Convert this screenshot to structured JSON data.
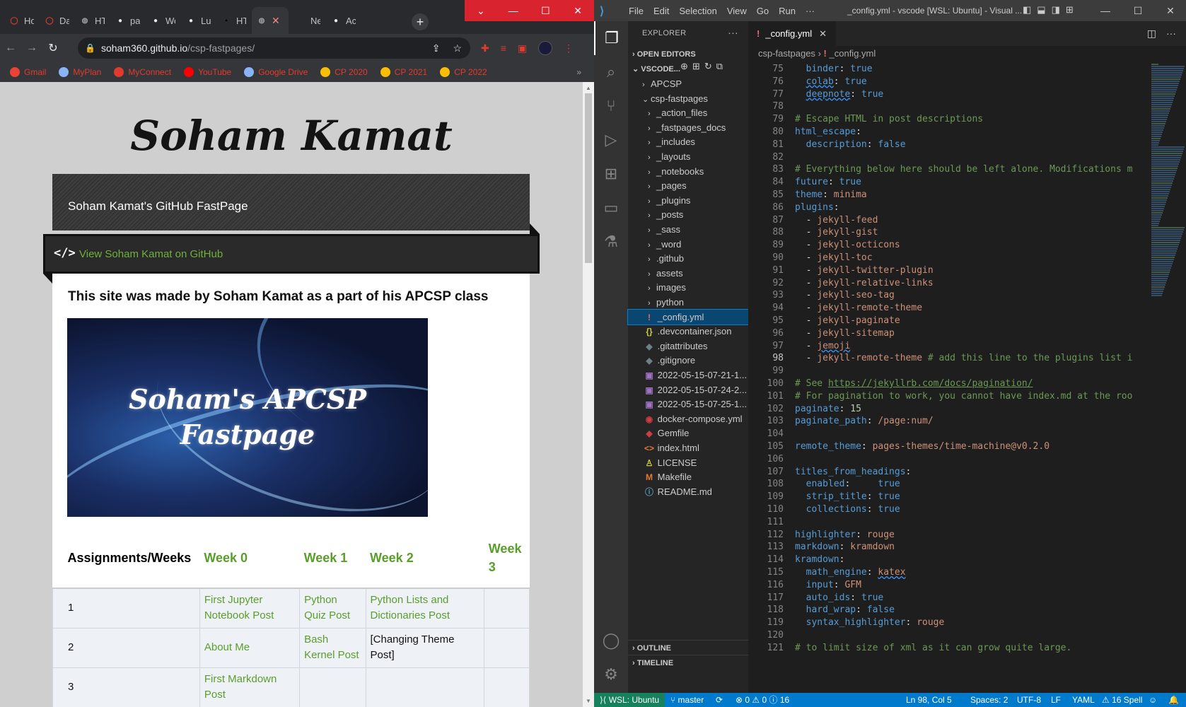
{
  "chrome": {
    "tabs": [
      {
        "label": "Ho",
        "icon": "opera-icon"
      },
      {
        "label": "Da",
        "icon": "opera-icon"
      },
      {
        "label": "HT",
        "icon": "globe-icon"
      },
      {
        "label": "pa",
        "icon": "github-icon"
      },
      {
        "label": "We",
        "icon": "github-icon"
      },
      {
        "label": "Luc",
        "icon": "github-icon"
      },
      {
        "label": "HT",
        "icon": "terminal-icon"
      },
      {
        "label": "",
        "icon": "globe-icon",
        "active": true
      },
      {
        "label": "Ne",
        "icon": "blank-icon"
      },
      {
        "label": "Ac",
        "icon": "github-icon"
      }
    ],
    "active_tab_close": "✕",
    "new_tab": "+",
    "window_controls": [
      "⌄",
      "—",
      "☐",
      "✕"
    ],
    "url_host": "soham360.github.io",
    "url_path": "/csp-fastpages/",
    "bookmarks": [
      {
        "label": "Gmail",
        "color": "#ea4335"
      },
      {
        "label": "MyPlan",
        "color": "#8ab4f8"
      },
      {
        "label": "MyConnect",
        "color": "#e23b2e"
      },
      {
        "label": "YouTube",
        "color": "#ff0000"
      },
      {
        "label": "Google Drive",
        "color": "#8ab4f8"
      },
      {
        "label": "CP 2020",
        "color": "#fbbc04"
      },
      {
        "label": "CP 2021",
        "color": "#fbbc04"
      },
      {
        "label": "CP 2022",
        "color": "#fbbc04"
      }
    ],
    "bookmarks_more": "»"
  },
  "site": {
    "title": "Soham Kamat",
    "header": "Soham Kamat's GitHub FastPage",
    "github_icon": "</>",
    "github_link": "View Soham Kamat on GitHub",
    "intro": "This site was made by Soham Kamat as a part of his APCSP class",
    "banner_line1": "Soham's APCSP",
    "banner_line2": "Fastpage",
    "table": {
      "headers": [
        "Assignments/Weeks",
        "Week 0",
        "Week 1",
        "Week 2",
        "Week 3"
      ],
      "rows": [
        [
          "1",
          "First Jupyter Notebook Post",
          "Python Quiz Post",
          "Python Lists and Dictionaries Post",
          ""
        ],
        [
          "2",
          "About Me",
          "Bash Kernel Post",
          "[Changing Theme Post]",
          ""
        ],
        [
          "3",
          "First Markdown Post",
          "",
          "",
          ""
        ]
      ]
    },
    "link_color": "#5a9e2a"
  },
  "vscode": {
    "menu": [
      "File",
      "Edit",
      "Selection",
      "View",
      "Go",
      "Run",
      "···"
    ],
    "window_title": "_config.yml - vscode [WSL: Ubuntu] - Visual ...",
    "explorer_label": "EXPLORER",
    "open_editors": "OPEN EDITORS",
    "workspace": "VSCODE...",
    "tree": [
      {
        "label": "APCSP",
        "kind": "folder",
        "depth": 1
      },
      {
        "label": "csp-fastpages",
        "kind": "folder-open",
        "depth": 1
      },
      {
        "label": "_action_files",
        "kind": "folder",
        "depth": 2
      },
      {
        "label": "_fastpages_docs",
        "kind": "folder",
        "depth": 2
      },
      {
        "label": "_includes",
        "kind": "folder",
        "depth": 2
      },
      {
        "label": "_layouts",
        "kind": "folder",
        "depth": 2
      },
      {
        "label": "_notebooks",
        "kind": "folder",
        "depth": 2
      },
      {
        "label": "_pages",
        "kind": "folder",
        "depth": 2
      },
      {
        "label": "_plugins",
        "kind": "folder",
        "depth": 2
      },
      {
        "label": "_posts",
        "kind": "folder",
        "depth": 2
      },
      {
        "label": "_sass",
        "kind": "folder",
        "depth": 2
      },
      {
        "label": "_word",
        "kind": "folder",
        "depth": 2
      },
      {
        "label": ".github",
        "kind": "folder",
        "depth": 2
      },
      {
        "label": "assets",
        "kind": "folder",
        "depth": 2
      },
      {
        "label": "images",
        "kind": "folder",
        "depth": 2
      },
      {
        "label": "python",
        "kind": "folder",
        "depth": 2
      },
      {
        "label": "_config.yml",
        "kind": "yml",
        "depth": 2,
        "selected": true
      },
      {
        "label": ".devcontainer.json",
        "kind": "json",
        "depth": 2
      },
      {
        "label": ".gitattributes",
        "kind": "git",
        "depth": 2
      },
      {
        "label": ".gitignore",
        "kind": "git",
        "depth": 2
      },
      {
        "label": "2022-05-15-07-21-1...",
        "kind": "img",
        "depth": 2
      },
      {
        "label": "2022-05-15-07-24-2...",
        "kind": "img",
        "depth": 2
      },
      {
        "label": "2022-05-15-07-25-1...",
        "kind": "img",
        "depth": 2
      },
      {
        "label": "docker-compose.yml",
        "kind": "docker",
        "depth": 2
      },
      {
        "label": "Gemfile",
        "kind": "gem",
        "depth": 2
      },
      {
        "label": "index.html",
        "kind": "html",
        "depth": 2
      },
      {
        "label": "LICENSE",
        "kind": "license",
        "depth": 2
      },
      {
        "label": "Makefile",
        "kind": "make",
        "depth": 2
      },
      {
        "label": "README.md",
        "kind": "info",
        "depth": 2
      }
    ],
    "outline": "OUTLINE",
    "timeline": "TIMELINE",
    "tab_label": "_config.yml",
    "breadcrumb_folder": "csp-fastpages",
    "breadcrumb_sep": "›",
    "breadcrumb_file": "_config.yml",
    "code_lines": [
      {
        "n": "75",
        "html": "  <span class='k'>binder</span>: <span class='k'>true</span>"
      },
      {
        "n": "76",
        "html": "  <span class='k u'>colab</span>: <span class='k'>true</span>"
      },
      {
        "n": "77",
        "html": "  <span class='k u'>deepnote</span>: <span class='k'>true</span>"
      },
      {
        "n": "78",
        "html": ""
      },
      {
        "n": "79",
        "html": "<span class='c'># Escape HTML in post descriptions</span>"
      },
      {
        "n": "80",
        "html": "<span class='k'>html_escape</span>:"
      },
      {
        "n": "81",
        "html": "  <span class='k'>description</span>: <span class='k'>false</span>"
      },
      {
        "n": "82",
        "html": ""
      },
      {
        "n": "83",
        "html": "<span class='c'># Everything below here should be left alone. Modifications m</span>"
      },
      {
        "n": "84",
        "html": "<span class='k'>future</span>: <span class='k'>true</span>"
      },
      {
        "n": "85",
        "html": "<span class='k'>theme</span>: <span class='v'>minima</span>"
      },
      {
        "n": "86",
        "html": "<span class='k'>plugins</span>:"
      },
      {
        "n": "87",
        "html": "  - <span class='v'>jekyll-feed</span>"
      },
      {
        "n": "88",
        "html": "  - <span class='v'>jekyll-gist</span>"
      },
      {
        "n": "89",
        "html": "  - <span class='v'>jekyll-octicons</span>"
      },
      {
        "n": "90",
        "html": "  - <span class='v'>jekyll-toc</span>"
      },
      {
        "n": "91",
        "html": "  - <span class='v'>jekyll-twitter-plugin</span>"
      },
      {
        "n": "92",
        "html": "  - <span class='v'>jekyll-relative-links</span>"
      },
      {
        "n": "93",
        "html": "  - <span class='v'>jekyll-seo-tag</span>"
      },
      {
        "n": "94",
        "html": "  - <span class='v'>jekyll-remote-theme</span>"
      },
      {
        "n": "95",
        "html": "  - <span class='v'>jekyll-paginate</span>"
      },
      {
        "n": "96",
        "html": "  - <span class='v'>jekyll-sitemap</span>"
      },
      {
        "n": "97",
        "html": "  - <span class='v u'>jemoji</span>"
      },
      {
        "n": "98",
        "html": "  - <span class='v'>jekyll-remote-theme</span> <span class='c'># add this line to the plugins list i</span>",
        "current": true
      },
      {
        "n": "99",
        "html": ""
      },
      {
        "n": "100",
        "html": "<span class='c'># See </span><span class='lk2'>https://jekyllrb.com/docs/pagination/</span>"
      },
      {
        "n": "101",
        "html": "<span class='c'># For pagination to work, you cannot have index.md at the roo</span>"
      },
      {
        "n": "102",
        "html": "<span class='k'>paginate</span>: <span class='n'>15</span>"
      },
      {
        "n": "103",
        "html": "<span class='k'>paginate_path</span>: <span class='v'>/page:num/</span>"
      },
      {
        "n": "104",
        "html": ""
      },
      {
        "n": "105",
        "html": "<span class='k'>remote_theme</span>: <span class='v'>pages-themes/time-machine@v0.2.0</span>"
      },
      {
        "n": "106",
        "html": ""
      },
      {
        "n": "107",
        "html": "<span class='k'>titles_from_headings</span>:"
      },
      {
        "n": "108",
        "html": "  <span class='k'>enabled</span>:     <span class='k'>true</span>"
      },
      {
        "n": "109",
        "html": "  <span class='k'>strip_title</span>: <span class='k'>true</span>"
      },
      {
        "n": "110",
        "html": "  <span class='k'>collections</span>: <span class='k'>true</span>"
      },
      {
        "n": "111",
        "html": ""
      },
      {
        "n": "112",
        "html": "<span class='k'>highlighter</span>: <span class='v'>rouge</span>"
      },
      {
        "n": "113",
        "html": "<span class='k'>markdown</span>: <span class='v'>kramdown</span>"
      },
      {
        "n": "114",
        "html": "<span class='k'>kramdown</span>:"
      },
      {
        "n": "115",
        "html": "  <span class='k'>math_engine</span>: <span class='v u'>katex</span>"
      },
      {
        "n": "116",
        "html": "  <span class='k'>input</span>: <span class='v'>GFM</span>"
      },
      {
        "n": "117",
        "html": "  <span class='k'>auto_ids</span>: <span class='k'>true</span>"
      },
      {
        "n": "118",
        "html": "  <span class='k'>hard_wrap</span>: <span class='k'>false</span>"
      },
      {
        "n": "119",
        "html": "  <span class='k'>syntax_highlighter</span>: <span class='v'>rouge</span>"
      },
      {
        "n": "120",
        "html": ""
      },
      {
        "n": "121",
        "html": "<span class='c'># to limit size of xml as it can grow quite large.</span>"
      }
    ],
    "status": {
      "remote": "WSL: Ubuntu",
      "branch": "master",
      "sync": "⟳",
      "problems": "⊗ 0 ⚠ 0 ⓘ 16",
      "position": "Ln 98, Col 5",
      "spaces": "Spaces: 2",
      "encoding": "UTF-8",
      "eol": "LF",
      "language": "YAML",
      "spell": "⚠ 16 Spell"
    }
  }
}
